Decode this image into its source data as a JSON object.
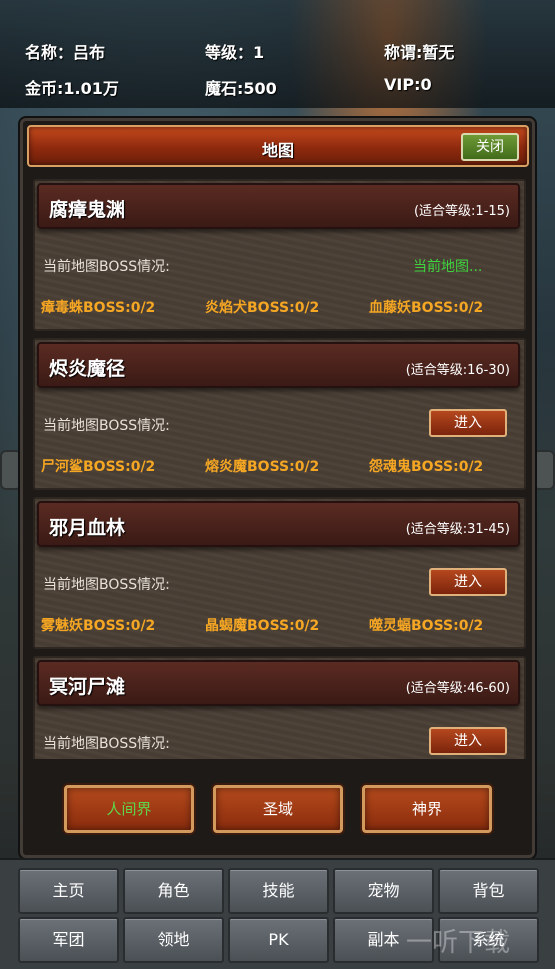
{
  "player": {
    "name": "名称：吕布",
    "level": "等级：1",
    "title": "称谓:暂无",
    "gold": "金币:1.01万",
    "magic_stone": "魔石:500",
    "vip": "VIP:0"
  },
  "panel": {
    "title": "地图",
    "close_label": "关闭"
  },
  "maps": [
    {
      "name": "腐瘴鬼渊",
      "level_range": "(适合等级:1-15)",
      "boss_label": "当前地图BOSS情况:",
      "status": "当前地图...",
      "bosses": [
        "瘴毒蛛BOSS:0/2",
        "炎焰犬BOSS:0/2",
        "血藤妖BOSS:0/2"
      ]
    },
    {
      "name": "烬炎魔径",
      "level_range": "(适合等级:16-30)",
      "boss_label": "当前地图BOSS情况:",
      "enter_label": "进入",
      "bosses": [
        "尸河鲨BOSS:0/2",
        "熔炎魔BOSS:0/2",
        "怨魂鬼BOSS:0/2"
      ]
    },
    {
      "name": "邪月血林",
      "level_range": "(适合等级:31-45)",
      "boss_label": "当前地图BOSS情况:",
      "enter_label": "进入",
      "bosses": [
        "雾魅妖BOSS:0/2",
        "晶蝎魔BOSS:0/2",
        "噬灵蝠BOSS:0/2"
      ]
    },
    {
      "name": "冥河尸滩",
      "level_range": "(适合等级:46-60)",
      "boss_label": "当前地图BOSS情况:",
      "enter_label": "进入",
      "bosses": []
    }
  ],
  "realms": [
    {
      "label": "人间界",
      "active": true
    },
    {
      "label": "圣域",
      "active": false
    },
    {
      "label": "神界",
      "active": false
    }
  ],
  "nav": {
    "row1": [
      "主页",
      "角色",
      "技能",
      "宠物",
      "背包"
    ],
    "row2": [
      "军团",
      "领地",
      "PK",
      "副本",
      "系统"
    ]
  },
  "watermark": "一听下载",
  "colors": {
    "accent_orange": "#b5481e",
    "boss_text": "#f5a623",
    "current_green": "#3ed43e",
    "realm_active": "#5fd64a"
  }
}
